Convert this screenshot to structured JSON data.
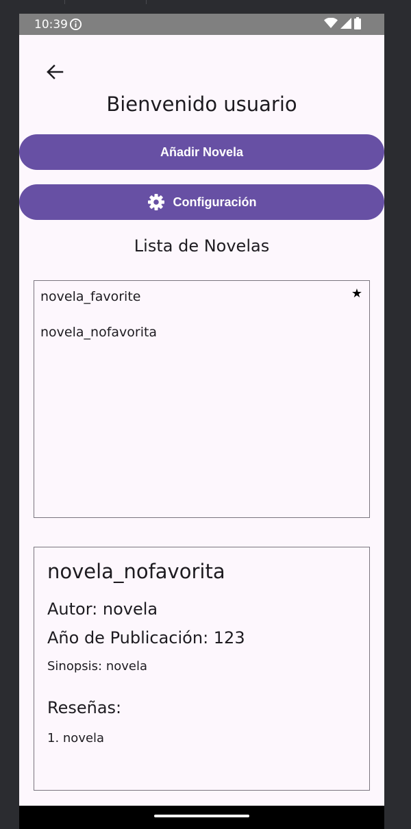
{
  "status_bar": {
    "time": "10:39",
    "icons": [
      "info-icon",
      "wifi-icon",
      "signal-icon",
      "battery-icon"
    ]
  },
  "header": {
    "back_icon": "arrow-left-icon",
    "title": "Bienvenido usuario"
  },
  "buttons": {
    "add_novel_label": "Añadir Novela",
    "settings_label": "Configuración",
    "settings_icon": "gear-icon"
  },
  "novel_list": {
    "title": "Lista de Novelas",
    "items": [
      {
        "label": "novela_favorite",
        "favorite": true
      },
      {
        "label": "novela_nofavorita",
        "favorite": false
      }
    ],
    "favorite_icon": "★"
  },
  "detail": {
    "title": "novela_nofavorita",
    "author": "Autor: novela",
    "year": "Año de Publicación: 123",
    "synopsis": "Sinopsis: novela",
    "reviews_heading": "Reseñas:",
    "reviews": [
      "1. novela"
    ]
  },
  "colors": {
    "primary": "#6750a4",
    "background": "#fdf7fd",
    "status_bar": "#808080",
    "border": "#79747e"
  }
}
